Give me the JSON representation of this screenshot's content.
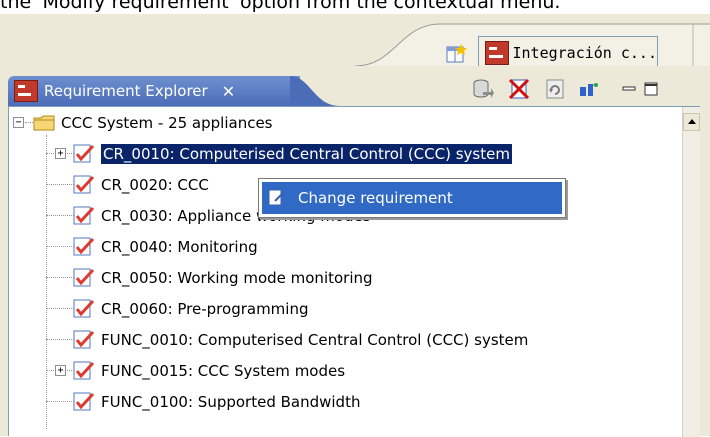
{
  "caption": "the 'Modify requirement' option from the contextual menu.",
  "perspective": {
    "label": "Integración c..."
  },
  "view": {
    "title": "Requirement Explorer",
    "close": "✕"
  },
  "tree": {
    "root": "CCC System - 25 appliances",
    "items": [
      "CR_0010: Computerised Central Control (CCC) system",
      "CR_0020: CCC",
      "CR_0030: Appliance working modes",
      "CR_0040: Monitoring",
      "CR_0050: Working mode monitoring",
      "CR_0060: Pre-programming",
      "FUNC_0010: Computerised Central Control (CCC) system",
      "FUNC_0015: CCC System modes",
      "FUNC_0100: Supported Bandwidth"
    ]
  },
  "context_menu": {
    "item": "Change requirement"
  },
  "colors": {
    "selection": "#0a246a",
    "menu_highlight": "#316ac5",
    "tab": "#4b6db7"
  }
}
